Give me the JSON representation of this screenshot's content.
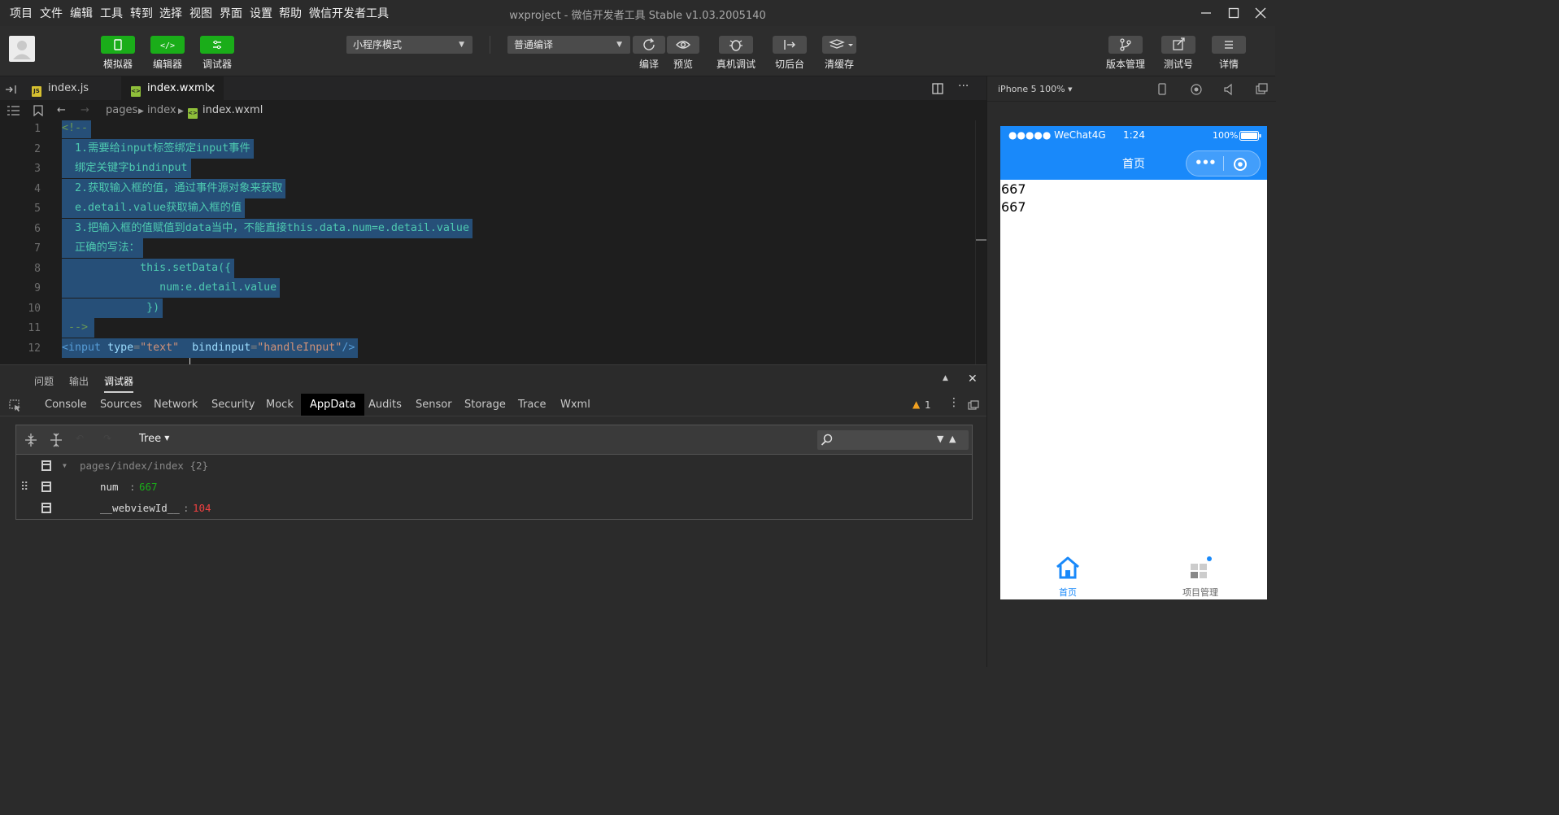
{
  "menu": {
    "items": [
      "项目",
      "文件",
      "编辑",
      "工具",
      "转到",
      "选择",
      "视图",
      "界面",
      "设置",
      "帮助",
      "微信开发者工具"
    ],
    "title": "wxproject - 微信开发者工具 Stable v1.03.2005140"
  },
  "toolbar": {
    "simulator_label": "模拟器",
    "editor_label": "编辑器",
    "debugger_label": "调试器",
    "mode_select": "小程序模式",
    "compile_select": "普通编译",
    "compile_label": "编译",
    "preview_label": "预览",
    "remote_debug_label": "真机调试",
    "background_label": "切后台",
    "clear_cache_label": "清缓存",
    "version_label": "版本管理",
    "test_label": "测试号",
    "details_label": "详情"
  },
  "tabs": [
    {
      "label": "index.js",
      "badge": "JS"
    },
    {
      "label": "index.wxml",
      "badge": "<>"
    }
  ],
  "breadcrumb": [
    "pages",
    "index",
    "index.wxml"
  ],
  "code_lines": [
    "<!--",
    "  1.需要给input标签绑定input事件",
    "  绑定关键字bindinput",
    "  2.获取输入框的值，通过事件源对象来获取",
    "  e.detail.value获取输入框的值",
    "  3.把输入框的值赋值到data当中，不能直接this.data.num=e.detail.value",
    "  正确的写法：",
    "            this.setData({",
    "               num:e.detail.value",
    "             })",
    " -->",
    "<input type=\"text\"  bindinput=\"handleInput\"/>"
  ],
  "code_tokens": {
    "open_tag": "<input",
    "attr_type": "type",
    "eq": "=",
    "val_type": "\"text\"",
    "attr_bind": "bindinput",
    "val_bind": "\"handleInput\"",
    "close": "/>"
  },
  "line_numbers": [
    "1",
    "2",
    "3",
    "4",
    "5",
    "6",
    "7",
    "8",
    "9",
    "10",
    "11",
    "12"
  ],
  "debug": {
    "panel_tabs": [
      "问题",
      "输出",
      "调试器"
    ],
    "dev_tabs": [
      "Console",
      "Sources",
      "Network",
      "Security",
      "Mock",
      "AppData",
      "Audits",
      "Sensor",
      "Storage",
      "Trace",
      "Wxml"
    ],
    "active_dev_tab": "AppData",
    "warning_count": "1",
    "view_select": "Tree",
    "tree": {
      "root": "pages/index/index {2}",
      "rows": [
        {
          "key": "num",
          "sep": ":",
          "value": "667",
          "value_color": "#1aad19"
        },
        {
          "key": "__webviewId__",
          "sep": ":",
          "value": "104",
          "value_color": "#f04040"
        }
      ]
    }
  },
  "simulator": {
    "device": "iPhone 5 100%",
    "status_left": "●●●●● WeChat4G",
    "status_time": "1:24",
    "status_battery": "100%",
    "nav_title": "首页",
    "page_lines": [
      "667",
      "667"
    ],
    "tabbar": [
      {
        "label": "首页",
        "color": "#1989fa"
      },
      {
        "label": "项目管理",
        "color": "#666666"
      }
    ]
  },
  "colors": {
    "accent_green": "#1aad19",
    "nav_blue": "#1989fa",
    "selection": "#264f78"
  }
}
